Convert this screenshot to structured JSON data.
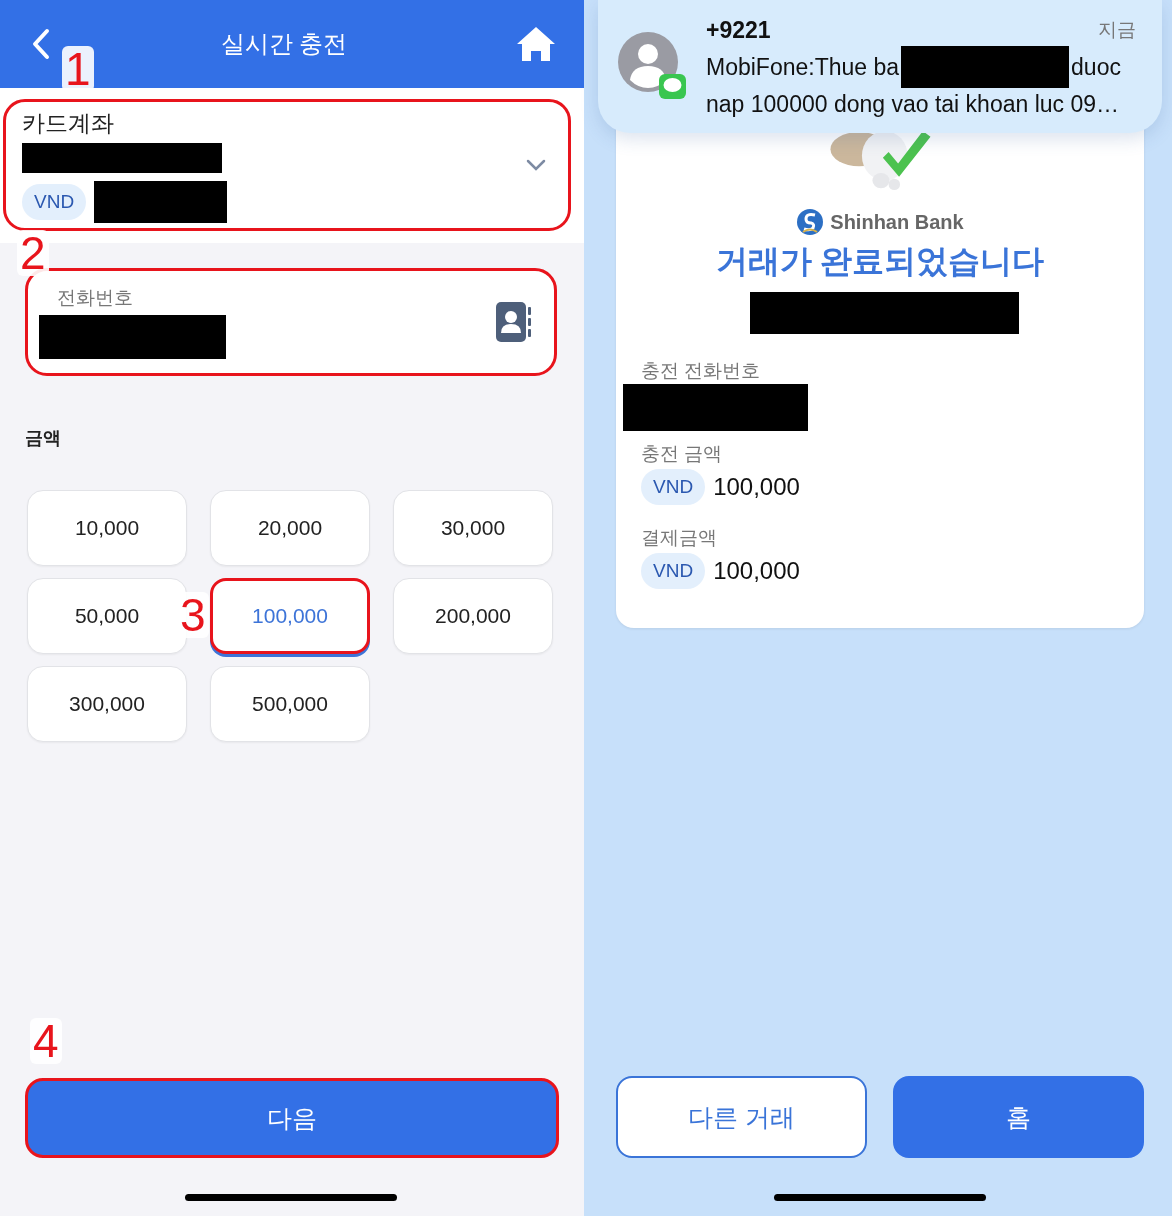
{
  "left": {
    "header": {
      "title": "실시간 충전"
    },
    "account": {
      "label": "카드계좌",
      "currency": "VND",
      "highlighted": true
    },
    "phone_field": {
      "label": "전화번호",
      "highlighted": true
    },
    "amount_label": "금액",
    "amounts": [
      {
        "label": "10,000",
        "selected": false,
        "highlighted": false
      },
      {
        "label": "20,000",
        "selected": false,
        "highlighted": false
      },
      {
        "label": "30,000",
        "selected": false,
        "highlighted": false
      },
      {
        "label": "50,000",
        "selected": false,
        "highlighted": false
      },
      {
        "label": "100,000",
        "selected": true,
        "highlighted": true
      },
      {
        "label": "200,000",
        "selected": false,
        "highlighted": false
      },
      {
        "label": "300,000",
        "selected": false,
        "highlighted": false
      },
      {
        "label": "500,000",
        "selected": false,
        "highlighted": false
      }
    ],
    "next_button": {
      "label": "다음",
      "highlighted": true
    },
    "annotations": [
      "1",
      "2",
      "3",
      "4"
    ]
  },
  "right": {
    "notification": {
      "sender": "+9221",
      "time": "지금",
      "message": [
        "MobiFone:Thue ba",
        "duoc",
        "nap 100000 dong vao tai khoan luc 09…"
      ]
    },
    "bank_name": "Shinhan Bank",
    "title": "거래가 완료되었습니다",
    "details": [
      {
        "label": "충전 전화번호",
        "kind": "redacted"
      },
      {
        "label": "충전 금액",
        "kind": "amount",
        "currency": "VND",
        "value": "100,000"
      },
      {
        "label": "결제금액",
        "kind": "amount",
        "currency": "VND",
        "value": "100,000"
      }
    ],
    "buttons": [
      {
        "label": "다른 거래",
        "kind": "outline"
      },
      {
        "label": "홈",
        "kind": "filled"
      }
    ]
  }
}
